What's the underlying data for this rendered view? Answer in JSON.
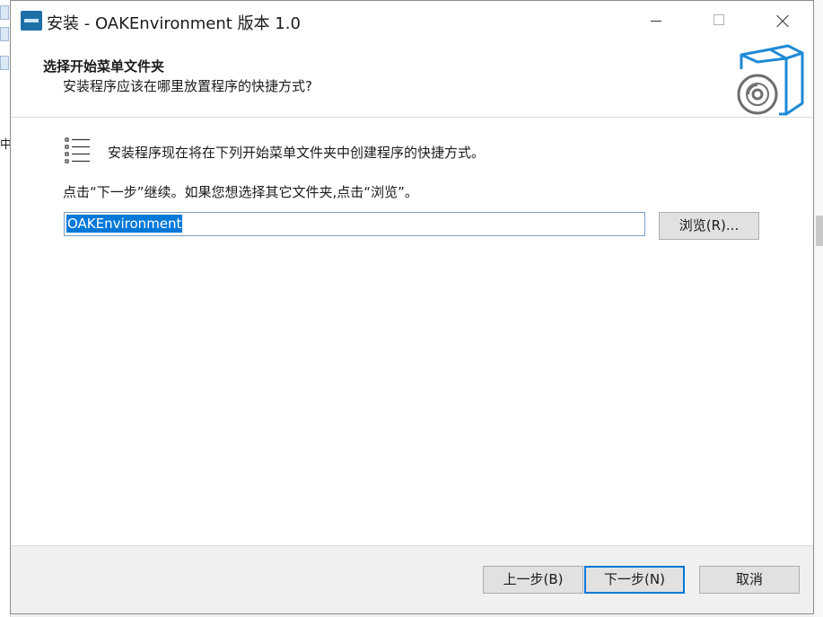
{
  "window": {
    "title": "安装 - OAKEnvironment 版本 1.0",
    "icons": {
      "app": "installer-app-icon",
      "minimize": "minimize-icon",
      "maximize": "maximize-icon",
      "close": "close-icon"
    }
  },
  "header": {
    "title": "选择开始菜单文件夹",
    "subtitle": "安装程序应该在哪里放置程序的快捷方式?",
    "icon": "software-box-cd-icon"
  },
  "content": {
    "icon": "list-icon",
    "info": "安装程序现在将在下列开始菜单文件夹中创建程序的快捷方式。",
    "hint": "点击“下一步”继续。如果您想选择其它文件夹,点击“浏览”。",
    "folder_value": "OAKEnvironment",
    "browse_label": "浏览(R)..."
  },
  "footer": {
    "back_label": "上一步(B)",
    "next_label": "下一步(N)",
    "cancel_label": "取消"
  },
  "background": {
    "left_text": "中"
  },
  "colors": {
    "accent": "#0078d7",
    "icon_blue": "#1e8ad6"
  }
}
